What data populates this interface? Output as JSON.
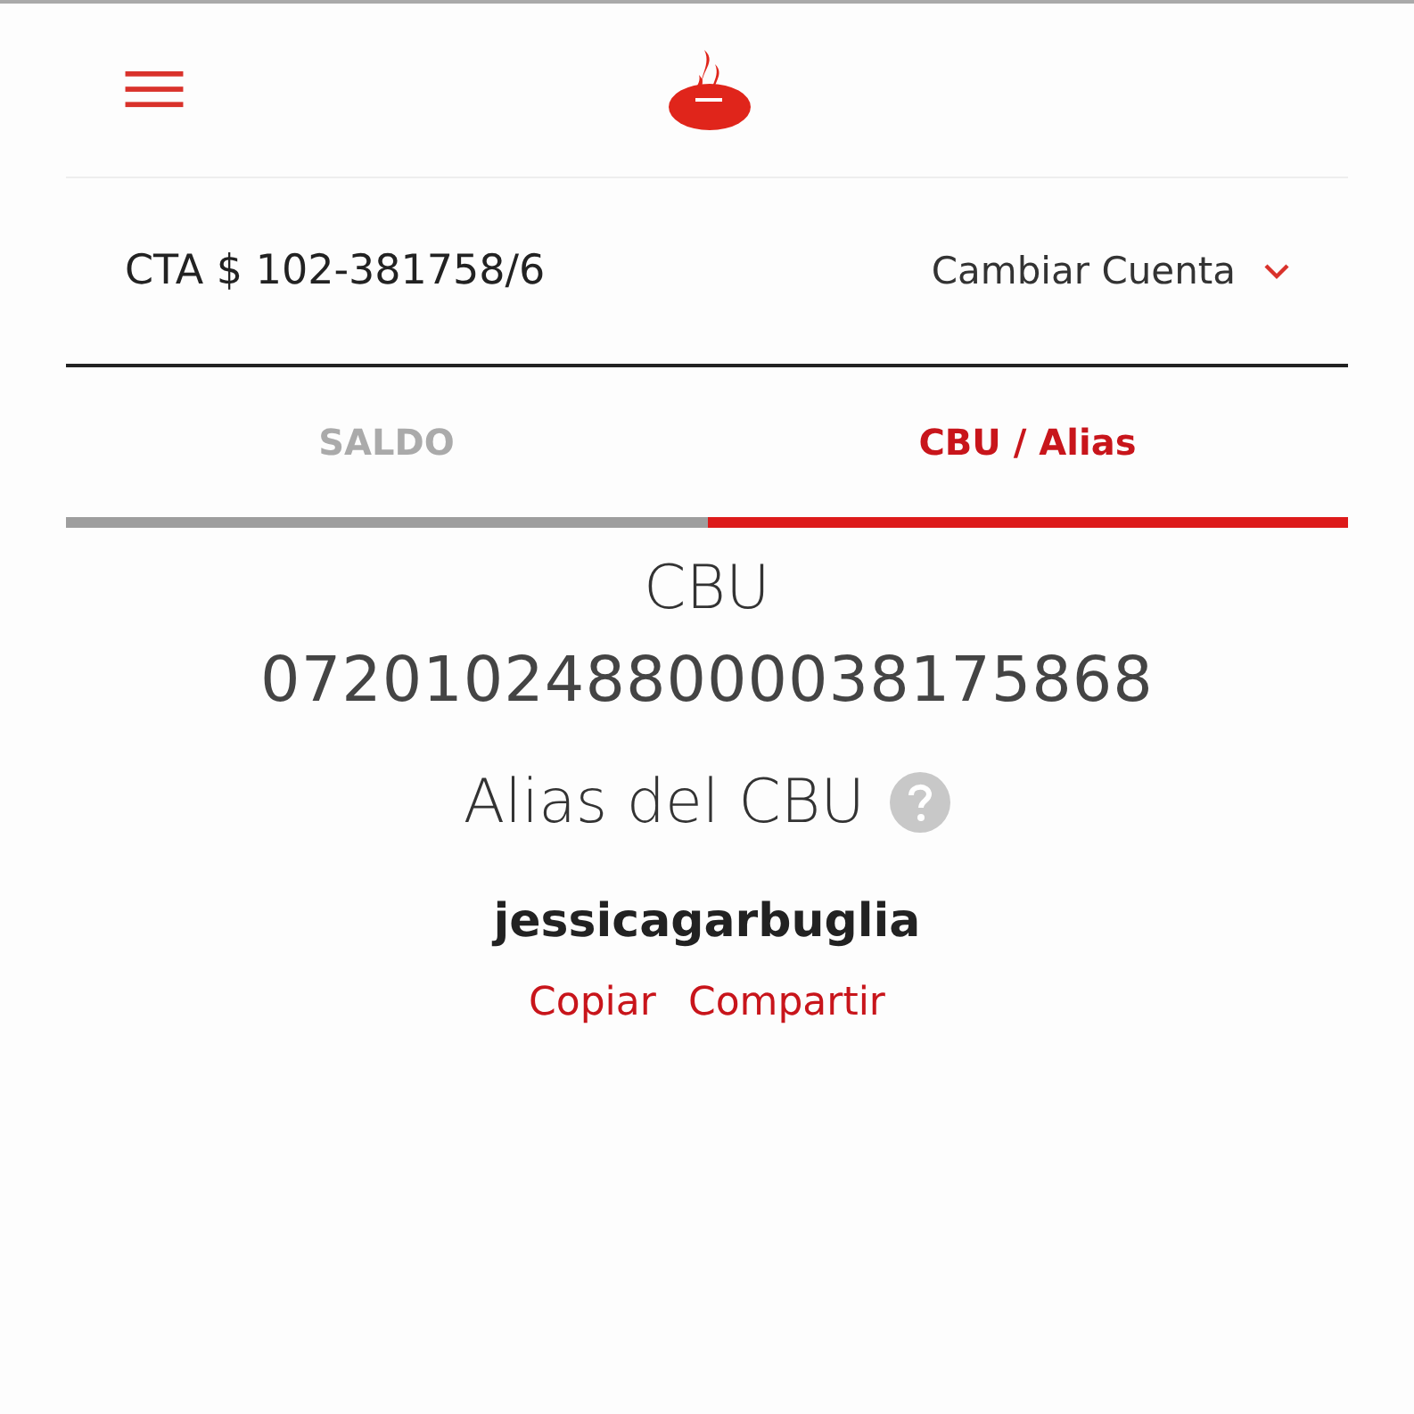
{
  "account": {
    "number": "CTA $ 102-381758/6",
    "switch_label": "Cambiar Cuenta"
  },
  "tabs": [
    {
      "label": "SALDO",
      "selected": false
    },
    {
      "label": "CBU / Alias",
      "selected": true
    }
  ],
  "cbu": {
    "title": "CBU",
    "number": "0720102488000038175868"
  },
  "alias": {
    "title": "Alias del CBU",
    "value": "jessicagarbuglia",
    "actions": [
      "Copiar",
      "Compartir"
    ]
  }
}
